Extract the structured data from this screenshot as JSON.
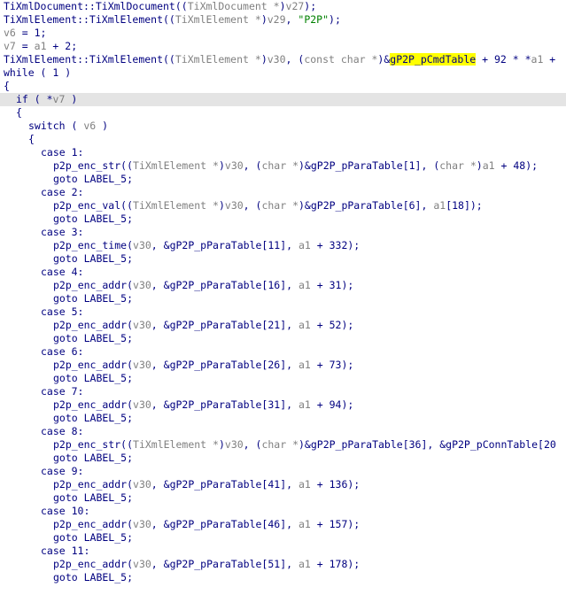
{
  "editor": {
    "highlight_line_index": 7,
    "colors": {
      "background": "#ffffff",
      "text": "#000080",
      "variable": "#808080",
      "string": "#008000",
      "current_line": "#e4e4e4",
      "search_highlight": "#ffff00"
    },
    "lines": [
      {
        "indent": 0,
        "tokens": [
          {
            "t": "TiXmlDocument::TiXmlDocument((",
            "k": "plain"
          },
          {
            "t": "TiXmlDocument *",
            "k": "var"
          },
          {
            "t": ")",
            "k": "plain"
          },
          {
            "t": "v27",
            "k": "var"
          },
          {
            "t": ");",
            "k": "plain"
          }
        ]
      },
      {
        "indent": 0,
        "tokens": [
          {
            "t": "TiXmlElement::TiXmlElement((",
            "k": "plain"
          },
          {
            "t": "TiXmlElement *",
            "k": "var"
          },
          {
            "t": ")",
            "k": "plain"
          },
          {
            "t": "v29",
            "k": "var"
          },
          {
            "t": ", ",
            "k": "plain"
          },
          {
            "t": "\"P2P\"",
            "k": "str"
          },
          {
            "t": ");",
            "k": "plain"
          }
        ]
      },
      {
        "indent": 0,
        "tokens": [
          {
            "t": "v6",
            "k": "var"
          },
          {
            "t": " = 1;",
            "k": "plain"
          }
        ]
      },
      {
        "indent": 0,
        "tokens": [
          {
            "t": "v7",
            "k": "var"
          },
          {
            "t": " = ",
            "k": "plain"
          },
          {
            "t": "a1",
            "k": "var"
          },
          {
            "t": " + 2;",
            "k": "plain"
          }
        ]
      },
      {
        "indent": 0,
        "tokens": [
          {
            "t": "TiXmlElement::TiXmlElement((",
            "k": "plain"
          },
          {
            "t": "TiXmlElement *",
            "k": "var"
          },
          {
            "t": ")",
            "k": "plain"
          },
          {
            "t": "v30",
            "k": "var"
          },
          {
            "t": ", (",
            "k": "plain"
          },
          {
            "t": "const char *",
            "k": "var"
          },
          {
            "t": ")&",
            "k": "plain"
          },
          {
            "t": "gP2P_pCmdTable",
            "k": "highlight"
          },
          {
            "t": " + 92 * *",
            "k": "plain"
          },
          {
            "t": "a1",
            "k": "var"
          },
          {
            "t": " +",
            "k": "plain"
          }
        ]
      },
      {
        "indent": 0,
        "tokens": [
          {
            "t": "while ( 1 )",
            "k": "plain"
          }
        ]
      },
      {
        "indent": 0,
        "tokens": [
          {
            "t": "{",
            "k": "plain"
          }
        ]
      },
      {
        "indent": 1,
        "tokens": [
          {
            "t": "if ( *",
            "k": "plain"
          },
          {
            "t": "v7",
            "k": "var"
          },
          {
            "t": " )",
            "k": "plain"
          }
        ]
      },
      {
        "indent": 1,
        "tokens": [
          {
            "t": "{",
            "k": "plain"
          }
        ]
      },
      {
        "indent": 2,
        "tokens": [
          {
            "t": "switch ( ",
            "k": "plain"
          },
          {
            "t": "v6",
            "k": "var"
          },
          {
            "t": " )",
            "k": "plain"
          }
        ]
      },
      {
        "indent": 2,
        "tokens": [
          {
            "t": "{",
            "k": "plain"
          }
        ]
      },
      {
        "indent": 3,
        "tokens": [
          {
            "t": "case 1:",
            "k": "plain"
          }
        ]
      },
      {
        "indent": 4,
        "tokens": [
          {
            "t": "p2p_enc_str((",
            "k": "plain"
          },
          {
            "t": "TiXmlElement *",
            "k": "var"
          },
          {
            "t": ")",
            "k": "plain"
          },
          {
            "t": "v30",
            "k": "var"
          },
          {
            "t": ", (",
            "k": "plain"
          },
          {
            "t": "char *",
            "k": "var"
          },
          {
            "t": ")&gP2P_pParaTable[1], (",
            "k": "plain"
          },
          {
            "t": "char *",
            "k": "var"
          },
          {
            "t": ")",
            "k": "plain"
          },
          {
            "t": "a1",
            "k": "var"
          },
          {
            "t": " + 48);",
            "k": "plain"
          }
        ]
      },
      {
        "indent": 4,
        "tokens": [
          {
            "t": "goto LABEL_5;",
            "k": "plain"
          }
        ]
      },
      {
        "indent": 3,
        "tokens": [
          {
            "t": "case 2:",
            "k": "plain"
          }
        ]
      },
      {
        "indent": 4,
        "tokens": [
          {
            "t": "p2p_enc_val((",
            "k": "plain"
          },
          {
            "t": "TiXmlElement *",
            "k": "var"
          },
          {
            "t": ")",
            "k": "plain"
          },
          {
            "t": "v30",
            "k": "var"
          },
          {
            "t": ", (",
            "k": "plain"
          },
          {
            "t": "char *",
            "k": "var"
          },
          {
            "t": ")&gP2P_pParaTable[6], ",
            "k": "plain"
          },
          {
            "t": "a1",
            "k": "var"
          },
          {
            "t": "[18]);",
            "k": "plain"
          }
        ]
      },
      {
        "indent": 4,
        "tokens": [
          {
            "t": "goto LABEL_5;",
            "k": "plain"
          }
        ]
      },
      {
        "indent": 3,
        "tokens": [
          {
            "t": "case 3:",
            "k": "plain"
          }
        ]
      },
      {
        "indent": 4,
        "tokens": [
          {
            "t": "p2p_enc_time(",
            "k": "plain"
          },
          {
            "t": "v30",
            "k": "var"
          },
          {
            "t": ", &gP2P_pParaTable[11], ",
            "k": "plain"
          },
          {
            "t": "a1",
            "k": "var"
          },
          {
            "t": " + 332);",
            "k": "plain"
          }
        ]
      },
      {
        "indent": 4,
        "tokens": [
          {
            "t": "goto LABEL_5;",
            "k": "plain"
          }
        ]
      },
      {
        "indent": 3,
        "tokens": [
          {
            "t": "case 4:",
            "k": "plain"
          }
        ]
      },
      {
        "indent": 4,
        "tokens": [
          {
            "t": "p2p_enc_addr(",
            "k": "plain"
          },
          {
            "t": "v30",
            "k": "var"
          },
          {
            "t": ", &gP2P_pParaTable[16], ",
            "k": "plain"
          },
          {
            "t": "a1",
            "k": "var"
          },
          {
            "t": " + 31);",
            "k": "plain"
          }
        ]
      },
      {
        "indent": 4,
        "tokens": [
          {
            "t": "goto LABEL_5;",
            "k": "plain"
          }
        ]
      },
      {
        "indent": 3,
        "tokens": [
          {
            "t": "case 5:",
            "k": "plain"
          }
        ]
      },
      {
        "indent": 4,
        "tokens": [
          {
            "t": "p2p_enc_addr(",
            "k": "plain"
          },
          {
            "t": "v30",
            "k": "var"
          },
          {
            "t": ", &gP2P_pParaTable[21], ",
            "k": "plain"
          },
          {
            "t": "a1",
            "k": "var"
          },
          {
            "t": " + 52);",
            "k": "plain"
          }
        ]
      },
      {
        "indent": 4,
        "tokens": [
          {
            "t": "goto LABEL_5;",
            "k": "plain"
          }
        ]
      },
      {
        "indent": 3,
        "tokens": [
          {
            "t": "case 6:",
            "k": "plain"
          }
        ]
      },
      {
        "indent": 4,
        "tokens": [
          {
            "t": "p2p_enc_addr(",
            "k": "plain"
          },
          {
            "t": "v30",
            "k": "var"
          },
          {
            "t": ", &gP2P_pParaTable[26], ",
            "k": "plain"
          },
          {
            "t": "a1",
            "k": "var"
          },
          {
            "t": " + 73);",
            "k": "plain"
          }
        ]
      },
      {
        "indent": 4,
        "tokens": [
          {
            "t": "goto LABEL_5;",
            "k": "plain"
          }
        ]
      },
      {
        "indent": 3,
        "tokens": [
          {
            "t": "case 7:",
            "k": "plain"
          }
        ]
      },
      {
        "indent": 4,
        "tokens": [
          {
            "t": "p2p_enc_addr(",
            "k": "plain"
          },
          {
            "t": "v30",
            "k": "var"
          },
          {
            "t": ", &gP2P_pParaTable[31], ",
            "k": "plain"
          },
          {
            "t": "a1",
            "k": "var"
          },
          {
            "t": " + 94);",
            "k": "plain"
          }
        ]
      },
      {
        "indent": 4,
        "tokens": [
          {
            "t": "goto LABEL_5;",
            "k": "plain"
          }
        ]
      },
      {
        "indent": 3,
        "tokens": [
          {
            "t": "case 8:",
            "k": "plain"
          }
        ]
      },
      {
        "indent": 4,
        "tokens": [
          {
            "t": "p2p_enc_str((",
            "k": "plain"
          },
          {
            "t": "TiXmlElement *",
            "k": "var"
          },
          {
            "t": ")",
            "k": "plain"
          },
          {
            "t": "v30",
            "k": "var"
          },
          {
            "t": ", (",
            "k": "plain"
          },
          {
            "t": "char *",
            "k": "var"
          },
          {
            "t": ")&gP2P_pParaTable[36], &gP2P_pConnTable[20",
            "k": "plain"
          }
        ]
      },
      {
        "indent": 4,
        "tokens": [
          {
            "t": "goto LABEL_5;",
            "k": "plain"
          }
        ]
      },
      {
        "indent": 3,
        "tokens": [
          {
            "t": "case 9:",
            "k": "plain"
          }
        ]
      },
      {
        "indent": 4,
        "tokens": [
          {
            "t": "p2p_enc_addr(",
            "k": "plain"
          },
          {
            "t": "v30",
            "k": "var"
          },
          {
            "t": ", &gP2P_pParaTable[41], ",
            "k": "plain"
          },
          {
            "t": "a1",
            "k": "var"
          },
          {
            "t": " + 136);",
            "k": "plain"
          }
        ]
      },
      {
        "indent": 4,
        "tokens": [
          {
            "t": "goto LABEL_5;",
            "k": "plain"
          }
        ]
      },
      {
        "indent": 3,
        "tokens": [
          {
            "t": "case 10:",
            "k": "plain"
          }
        ]
      },
      {
        "indent": 4,
        "tokens": [
          {
            "t": "p2p_enc_addr(",
            "k": "plain"
          },
          {
            "t": "v30",
            "k": "var"
          },
          {
            "t": ", &gP2P_pParaTable[46], ",
            "k": "plain"
          },
          {
            "t": "a1",
            "k": "var"
          },
          {
            "t": " + 157);",
            "k": "plain"
          }
        ]
      },
      {
        "indent": 4,
        "tokens": [
          {
            "t": "goto LABEL_5;",
            "k": "plain"
          }
        ]
      },
      {
        "indent": 3,
        "tokens": [
          {
            "t": "case 11:",
            "k": "plain"
          }
        ]
      },
      {
        "indent": 4,
        "tokens": [
          {
            "t": "p2p_enc_addr(",
            "k": "plain"
          },
          {
            "t": "v30",
            "k": "var"
          },
          {
            "t": ", &gP2P_pParaTable[51], ",
            "k": "plain"
          },
          {
            "t": "a1",
            "k": "var"
          },
          {
            "t": " + 178);",
            "k": "plain"
          }
        ]
      },
      {
        "indent": 4,
        "tokens": [
          {
            "t": "goto LABEL_5;",
            "k": "plain"
          }
        ]
      }
    ]
  }
}
